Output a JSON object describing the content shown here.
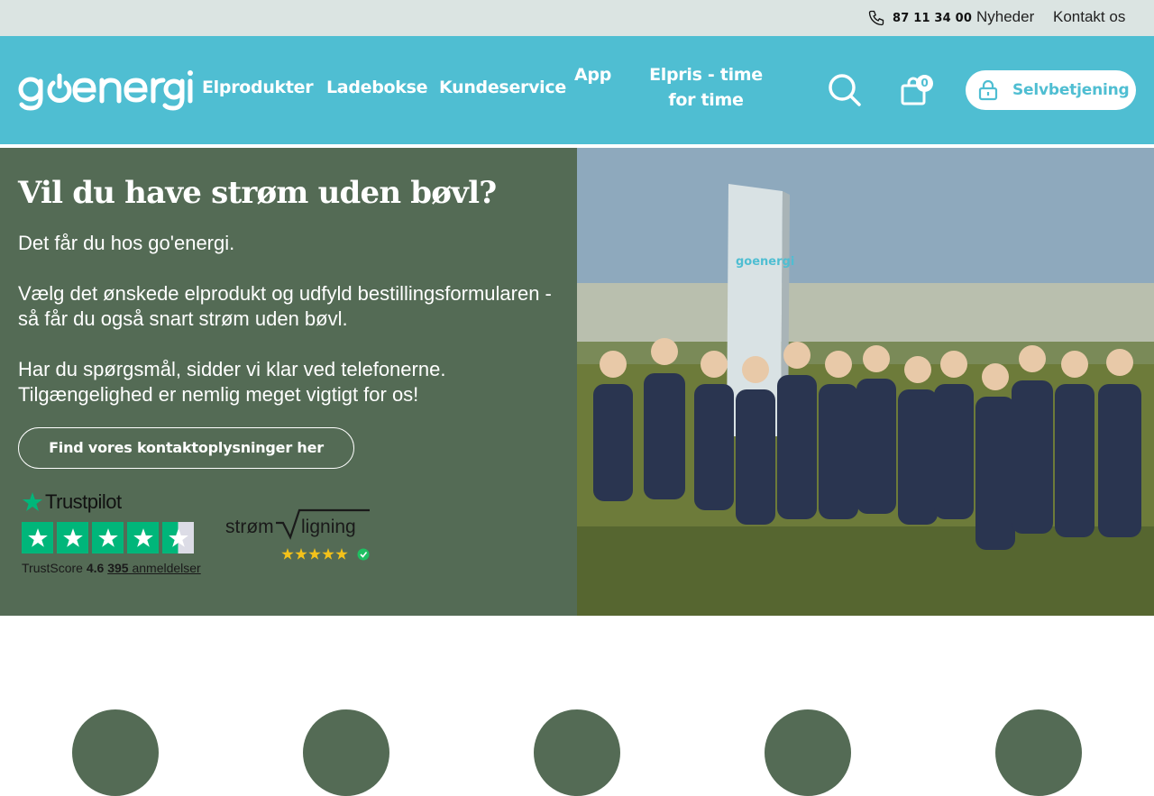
{
  "topbar": {
    "phone": "87 11 34 00",
    "links": [
      "Nyheder",
      "Kontakt os"
    ]
  },
  "header": {
    "logo_text": "goenergi",
    "nav": [
      "Elprodukter",
      "Ladebokse",
      "Kundeservice",
      "App",
      "Elpris - time for time"
    ],
    "cart_count": "0",
    "selfservice_label": "Selvbetjening"
  },
  "hero": {
    "title": "Vil du have strøm uden bøvl?",
    "p1": "Det får du hos go'energi.",
    "p2": "Vælg det ønskede elprodukt og udfyld bestillingsformularen - så får du også snart strøm uden bøvl.",
    "p3": "Har du spørgsmål, sidder vi klar ved telefonerne. Tilgængelighed er nemlig meget vigtigt for os!",
    "button": "Find vores kontaktoplysninger her",
    "trustpilot": {
      "brand": "Trustpilot",
      "label": "TrustScore",
      "score": "4.6",
      "count": "395",
      "count_label": "anmeldelser",
      "stars": 4.5
    },
    "stromligning": {
      "brand_left": "strøm",
      "brand_right": "ligning",
      "stars": 5
    },
    "sign_text": "goenergi"
  },
  "colors": {
    "header": "#4fbed2",
    "hero_green": "#546b55",
    "topbar": "#dbe4e2",
    "trustpilot_green": "#00b67a"
  }
}
